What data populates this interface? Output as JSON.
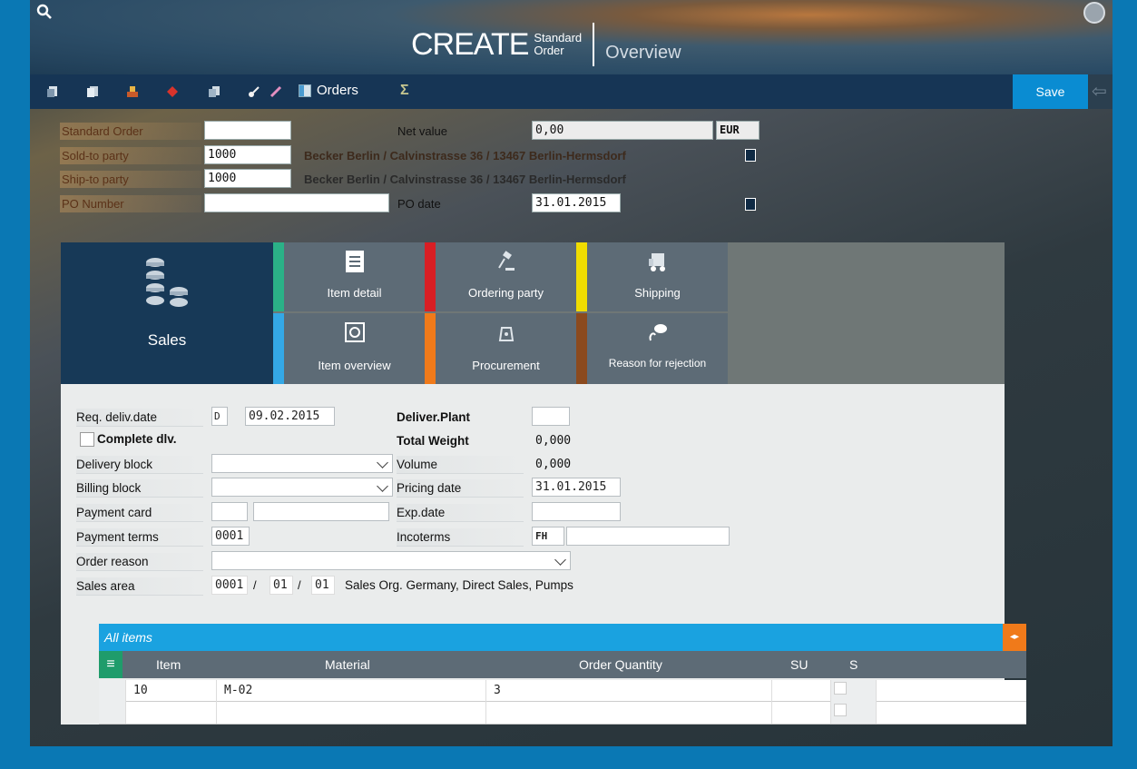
{
  "header": {
    "create": "CREATE",
    "subtitle_line1": "Standard",
    "subtitle_line2": "Order",
    "view": "Overview"
  },
  "toolbar": {
    "orders_label": "Orders",
    "sigma": "Σ",
    "save_label": "Save"
  },
  "form_top": {
    "standard_order_label": "Standard Order",
    "standard_order_value": "",
    "net_value_label": "Net value",
    "net_value": "0,00",
    "currency": "EUR",
    "sold_to_label": "Sold-to party",
    "sold_to_value": "1000",
    "sold_to_address": "Becker Berlin / Calvinstrasse 36 / 13467 Berlin-Hermsdorf",
    "ship_to_label": "Ship-to party",
    "ship_to_value": "1000",
    "ship_to_address": "Becker Berlin / Calvinstrasse 36 / 13467 Berlin-Hermsdorf",
    "po_number_label": "PO Number",
    "po_number_value": "",
    "po_date_label": "PO date",
    "po_date_value": "31.01.2015"
  },
  "tiles": {
    "sales": "Sales",
    "item_detail": "Item detail",
    "ordering_party": "Ordering party",
    "shipping": "Shipping",
    "item_overview": "Item overview",
    "procurement": "Procurement",
    "reason_for_rejection": "Reason for rejection",
    "colors": {
      "item_detail": "#2bb187",
      "ordering_party": "#d81e24",
      "shipping": "#f0dc00",
      "item_overview": "#34a8e6",
      "procurement": "#f07a1a",
      "reason_for_rejection": "#8b4a1e"
    }
  },
  "detail": {
    "req_deliv_label": "Req. deliv.date",
    "req_deliv_type": "D",
    "req_deliv_value": "09.02.2015",
    "complete_dlv_label": "Complete dlv.",
    "delivery_block_label": "Delivery block",
    "billing_block_label": "Billing block",
    "payment_card_label": "Payment card",
    "payment_terms_label": "Payment terms",
    "payment_terms_value": "0001",
    "order_reason_label": "Order reason",
    "sales_area_label": "Sales area",
    "sales_org": "0001",
    "dist_channel": "01",
    "division": "01",
    "sales_area_slash": "/",
    "sales_area_text": "Sales Org. Germany, Direct Sales, Pumps",
    "deliver_plant_label": "Deliver.Plant",
    "total_weight_label": "Total Weight",
    "total_weight_value": "0,000",
    "volume_label": "Volume",
    "volume_value": "0,000",
    "pricing_date_label": "Pricing date",
    "pricing_date_value": "31.01.2015",
    "exp_date_label": "Exp.date",
    "incoterms_label": "Incoterms",
    "incoterms_value": "FH"
  },
  "items": {
    "title": "All items",
    "columns": [
      "Item",
      "Material",
      "Order Quantity",
      "SU",
      "S"
    ],
    "rows": [
      {
        "item": "10",
        "material": "M-02",
        "qty": "3",
        "su": ""
      },
      {
        "item": "",
        "material": "",
        "qty": "",
        "su": ""
      }
    ]
  }
}
